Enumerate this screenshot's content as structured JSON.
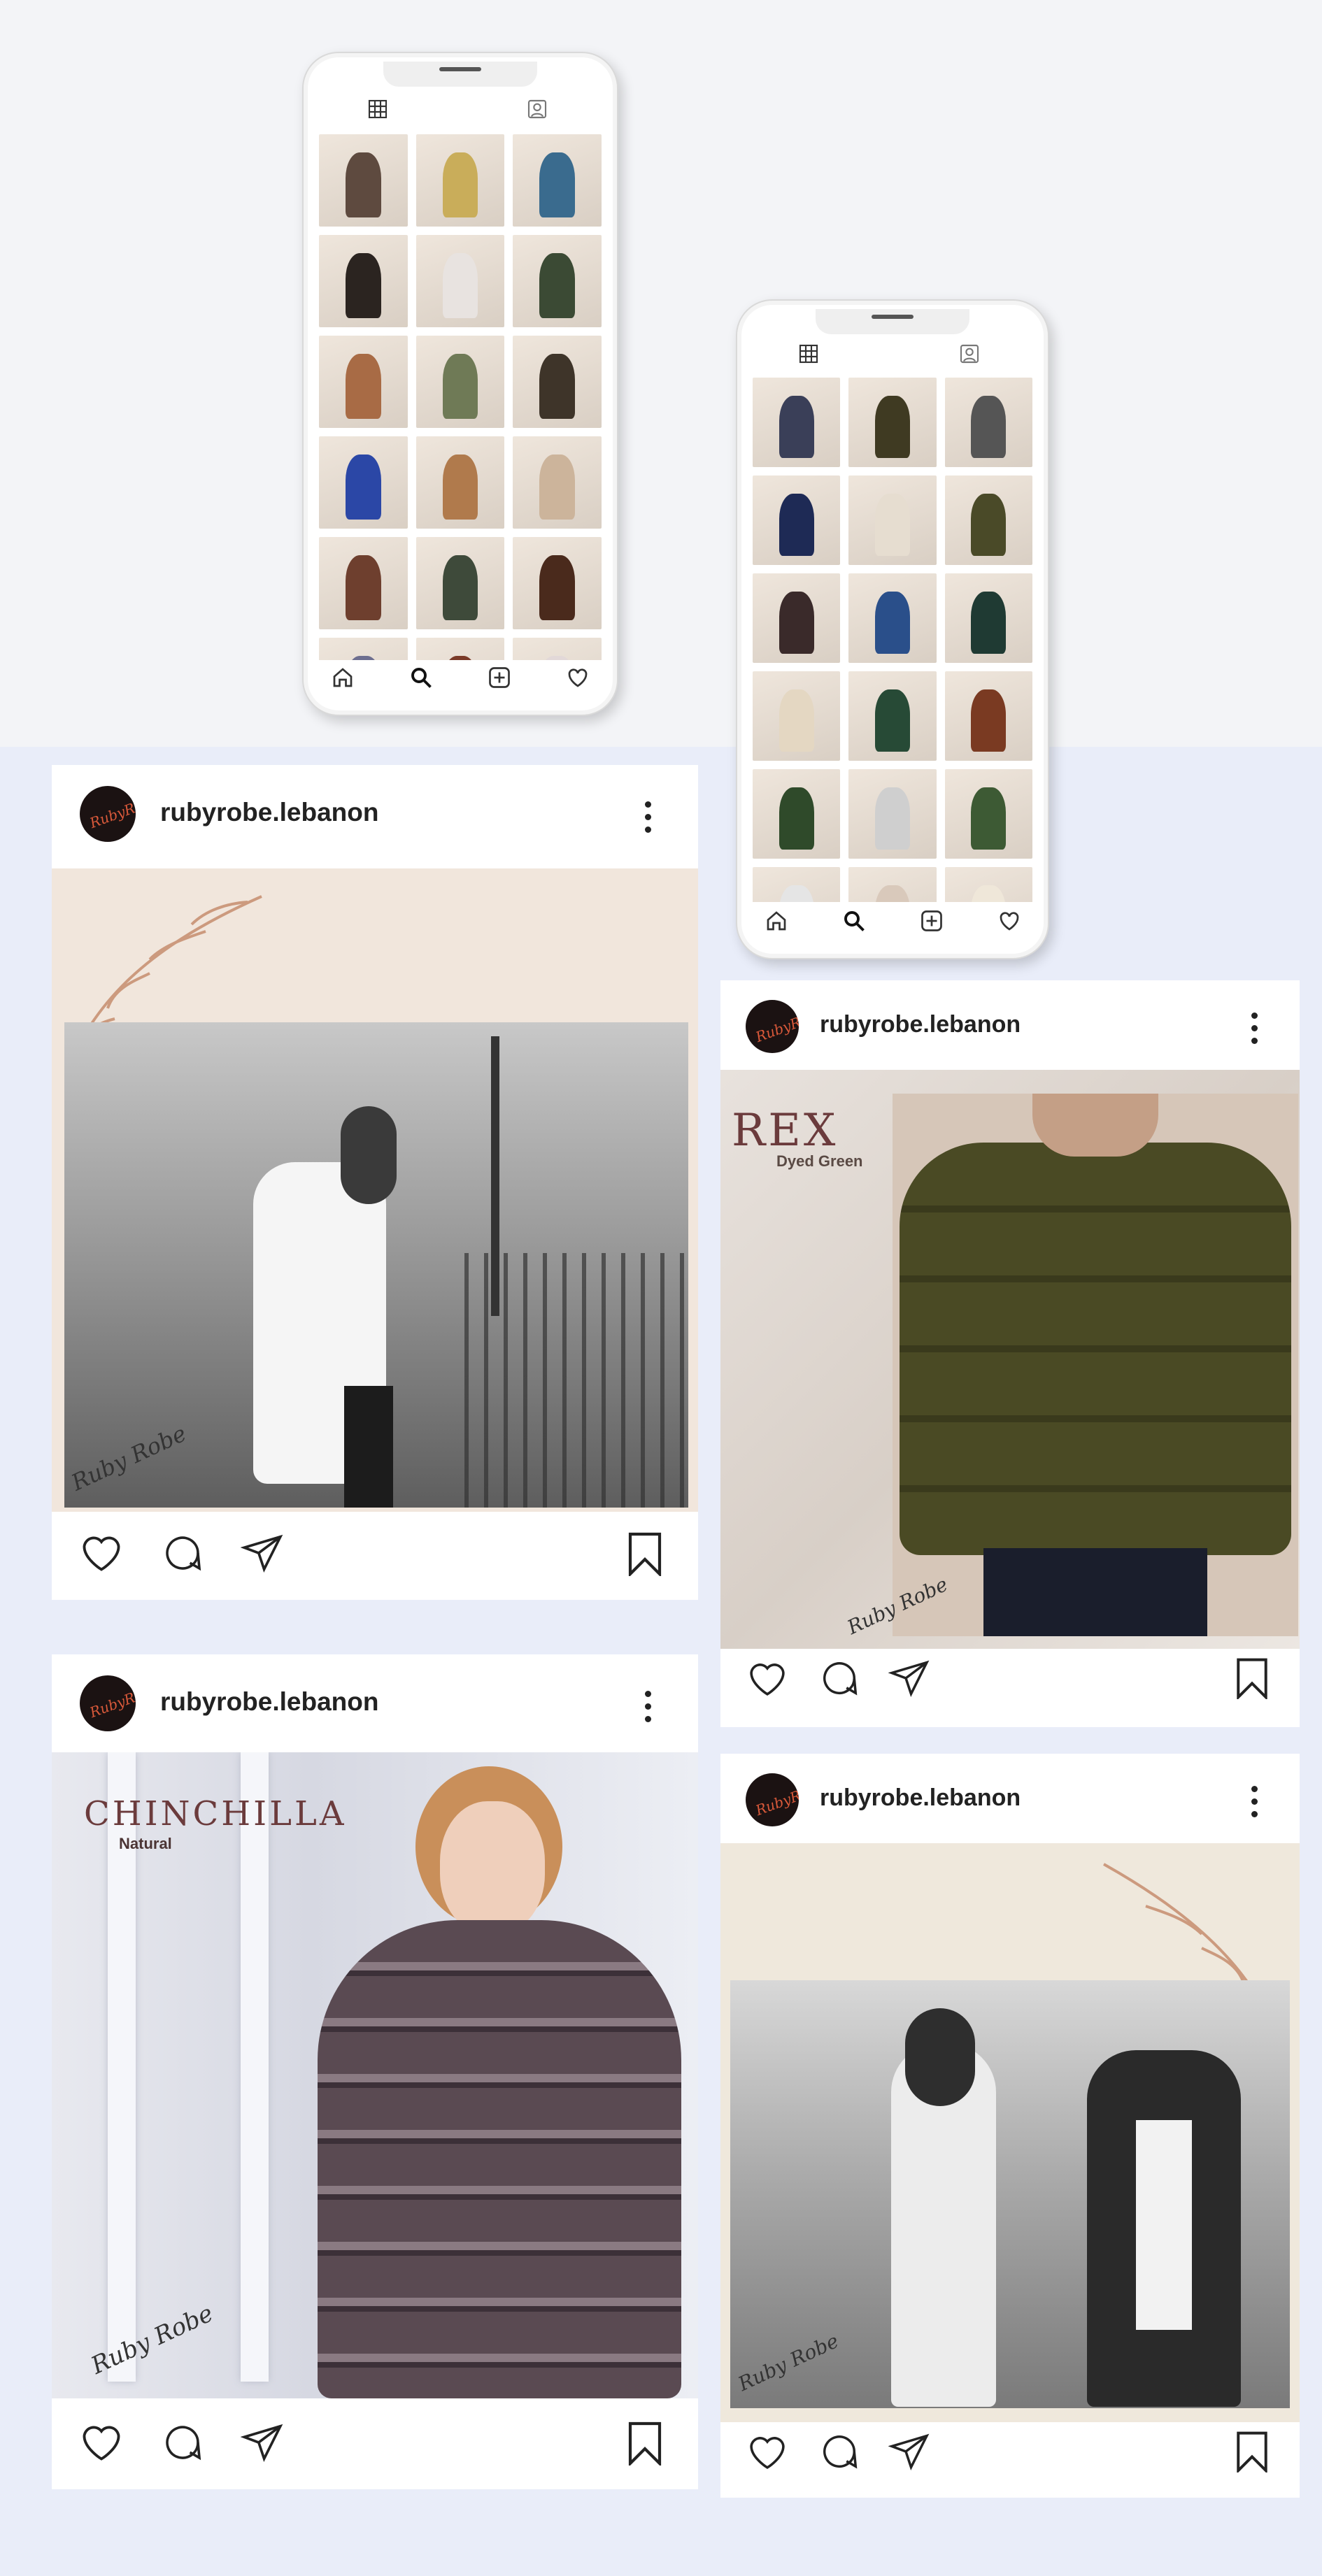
{
  "posts": [
    {
      "username": "rubyrobe.lebanon",
      "avatar_text": "RubyRobe",
      "signature": "Ruby Robe"
    },
    {
      "username": "rubyrobe.lebanon",
      "avatar_text": "RubyRobe",
      "title": "REX",
      "subtitle": "Dyed Green",
      "signature": "Ruby Robe"
    },
    {
      "username": "rubyrobe.lebanon",
      "avatar_text": "RubyRobe",
      "title": "CHINCHILLA",
      "subtitle": "Natural",
      "signature": "Ruby Robe"
    },
    {
      "username": "rubyrobe.lebanon",
      "avatar_text": "RubyRobe",
      "signature": "Ruby Robe"
    }
  ],
  "phone_left": {
    "thumb_colors": [
      "#5e4a3f",
      "#c9ad5a",
      "#3a6b8e",
      "#2b2420",
      "#e8e3e0",
      "#3b4a34",
      "#a86b45",
      "#6f7a56",
      "#3e3429",
      "#2b47a6",
      "#b07a4c",
      "#ccb49b",
      "#6e3f2e",
      "#3e4a3a",
      "#4a2a1c",
      "#6d6e8f",
      "#7a3a28",
      "#e2d8d8"
    ],
    "nav_icons": [
      "home-icon",
      "search-icon",
      "add-icon",
      "heart-icon"
    ]
  },
  "phone_right": {
    "thumb_colors": [
      "#3a3f58",
      "#3f3a22",
      "#555555",
      "#1e2a55",
      "#e6ddd0",
      "#4a4a28",
      "#3a2a2a",
      "#2a4f8a",
      "#1f3a33",
      "#e4d7c2",
      "#274a36",
      "#7a3a22",
      "#2f4a2a",
      "#cfcfcf",
      "#3d5a34",
      "#e5e5e5",
      "#d9c9bb",
      "#efe7d9"
    ],
    "nav_icons": [
      "home-icon",
      "search-icon",
      "add-icon",
      "heart-icon"
    ]
  }
}
